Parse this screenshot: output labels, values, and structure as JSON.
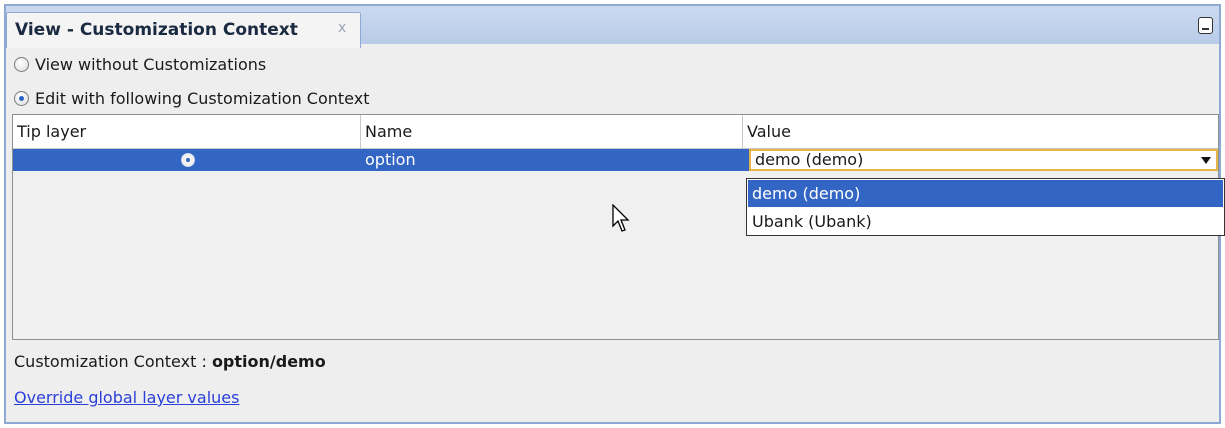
{
  "tab": {
    "title": "View - Customization Context",
    "close": "x"
  },
  "options": {
    "view_without": "View without Customizations",
    "edit_with": "Edit with following Customization Context"
  },
  "table": {
    "headers": [
      "Tip layer",
      "Name",
      "Value"
    ],
    "rows": [
      {
        "name": "option",
        "value": "demo (demo)"
      }
    ]
  },
  "dropdown": {
    "options": [
      "demo (demo)",
      "Ubank (Ubank)"
    ],
    "selected_index": 0
  },
  "footer": {
    "label": "Customization Context :",
    "value": "option/demo",
    "link": "Override global layer values"
  },
  "colors": {
    "selection": "#3366c4",
    "tab_bar": "#b8cbe8",
    "link": "#2a3fd8",
    "editor_border": "#e6b54a"
  }
}
